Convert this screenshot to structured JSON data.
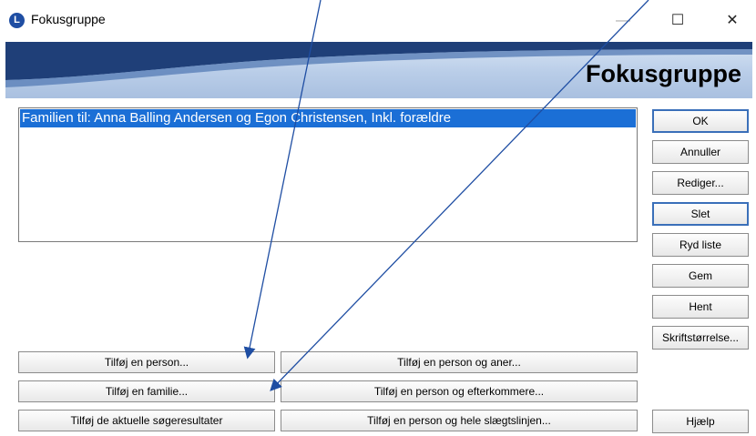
{
  "window": {
    "title": "Fokusgruppe",
    "logo_letter": "L",
    "minimize": "—",
    "maximize": "☐",
    "close": "✕"
  },
  "banner": {
    "title": "Fokusgruppe"
  },
  "list": {
    "items": [
      "Familien til: Anna Balling Andersen og Egon Christensen, Inkl. forældre"
    ]
  },
  "side_buttons": {
    "ok": "OK",
    "cancel": "Annuller",
    "edit": "Rediger...",
    "delete": "Slet",
    "clear": "Ryd liste",
    "save": "Gem",
    "load": "Hent",
    "font_size": "Skriftstørrelse...",
    "help": "Hjælp"
  },
  "bottom_buttons": {
    "add_person": "Tilføj en person...",
    "add_person_ancestors": "Tilføj en person og aner...",
    "add_family": "Tilføj en familie...",
    "add_person_descendants": "Tilføj en person og efterkommere...",
    "add_search_results": "Tilføj de aktuelle søgeresultater",
    "add_person_lineage": "Tilføj en person og hele slægtslinjen..."
  },
  "colors": {
    "selection": "#1b6fd6",
    "arrow": "#1f4ea3",
    "banner_dark": "#1f3f78"
  }
}
